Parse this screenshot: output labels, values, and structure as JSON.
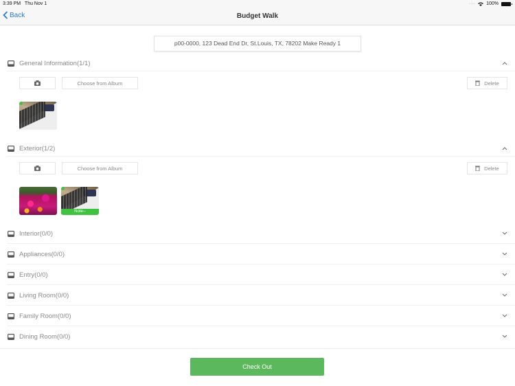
{
  "status_bar": {
    "time": "3:39 PM",
    "date": "Thu Nov 1",
    "battery": "100%",
    "icons": [
      "signal-dots-icon",
      "wifi-icon",
      "battery-icon"
    ]
  },
  "nav": {
    "back_label": "Back",
    "title": "Budget Walk"
  },
  "property": {
    "address": "p00-0000, 123 Dead End Dr, St.Louis, TX, 78202 Make Ready 1"
  },
  "buttons": {
    "camera_icon": "camera-icon",
    "album_label": "Choose from Album",
    "delete_label": "Delete"
  },
  "sections": [
    {
      "title": "General Information(1/1)",
      "expanded": true,
      "photos": [
        {
          "image": "laptop",
          "selected": true,
          "note": ""
        }
      ]
    },
    {
      "title": "Exterior(1/2)",
      "expanded": true,
      "photos": [
        {
          "image": "flowers",
          "selected": false,
          "note": ""
        },
        {
          "image": "laptop",
          "selected": true,
          "note": "Note--"
        }
      ]
    },
    {
      "title": "Interior(0/0)",
      "expanded": false
    },
    {
      "title": "Appliances(0/0)",
      "expanded": false
    },
    {
      "title": "Entry(0/0)",
      "expanded": false
    },
    {
      "title": "Living Room(0/0)",
      "expanded": false
    },
    {
      "title": "Family Room(0/0)",
      "expanded": false
    },
    {
      "title": "Dining Room(0/0)",
      "expanded": false
    }
  ],
  "footer": {
    "checkout_label": "Check Out"
  },
  "colors": {
    "accent_blue": "#2a7bd6",
    "checkout_green": "#5cb85c",
    "selected_dot": "#3fc23f"
  }
}
